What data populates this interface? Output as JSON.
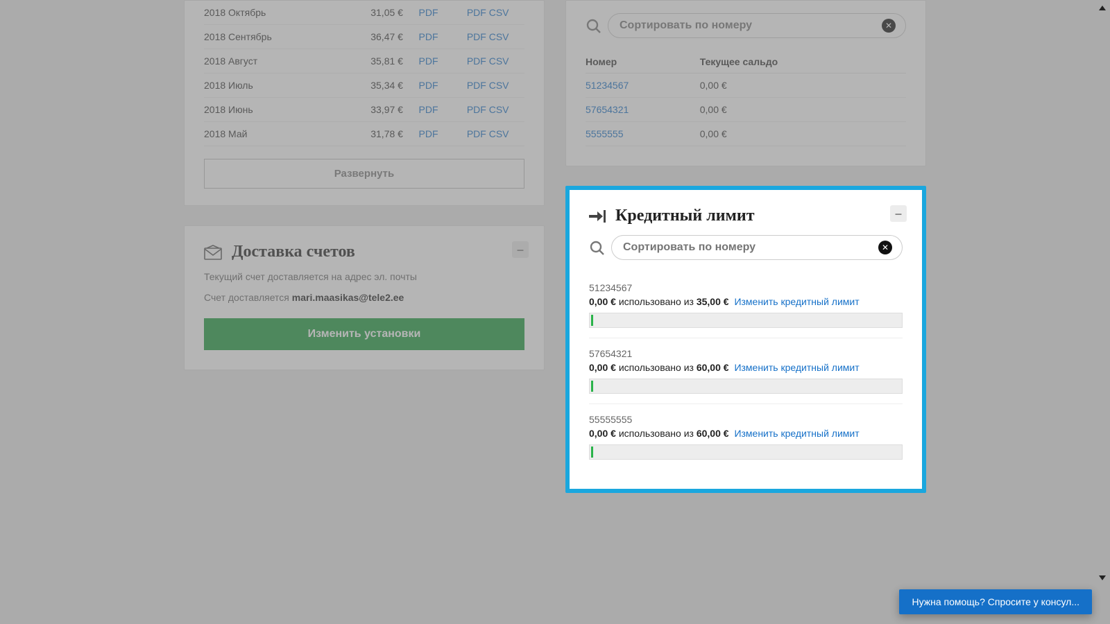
{
  "invoices": {
    "rows": [
      {
        "period": "2018 Октябрь",
        "amount": "31,05 €",
        "pdf": "PDF",
        "pdf2": "PDF",
        "csv": "CSV"
      },
      {
        "period": "2018 Сентябрь",
        "amount": "36,47 €",
        "pdf": "PDF",
        "pdf2": "PDF",
        "csv": "CSV"
      },
      {
        "period": "2018 Август",
        "amount": "35,81 €",
        "pdf": "PDF",
        "pdf2": "PDF",
        "csv": "CSV"
      },
      {
        "period": "2018 Июль",
        "amount": "35,34 €",
        "pdf": "PDF",
        "pdf2": "PDF",
        "csv": "CSV"
      },
      {
        "period": "2018 Июнь",
        "amount": "33,97 €",
        "pdf": "PDF",
        "pdf2": "PDF",
        "csv": "CSV"
      },
      {
        "period": "2018 Май",
        "amount": "31,78 €",
        "pdf": "PDF",
        "pdf2": "PDF",
        "csv": "CSV"
      }
    ],
    "expand": "Развернуть"
  },
  "delivery": {
    "title": "Доставка счетов",
    "line1": "Текущий счет доставляется на адрес эл. почты",
    "line2_prefix": "Счет доставляется ",
    "email": "mari.maasikas@tele2.ee",
    "change": "Изменить установки"
  },
  "balance": {
    "search_placeholder": "Сортировать по номеру",
    "head_num": "Номер",
    "head_bal": "Текущее сальдо",
    "rows": [
      {
        "num": "51234567",
        "bal": "0,00 €"
      },
      {
        "num": "57654321",
        "bal": "0,00 €"
      },
      {
        "num": "5555555",
        "bal": "0,00 €"
      }
    ]
  },
  "credit": {
    "title": "Кредитный лимит",
    "search_placeholder": "Сортировать по номеру",
    "change_label": "Изменить кредитный лимит",
    "used_word": "использовано из",
    "items": [
      {
        "num": "51234567",
        "used": "0,00 €",
        "limit": "35,00 €"
      },
      {
        "num": "57654321",
        "used": "0,00 €",
        "limit": "60,00 €"
      },
      {
        "num": "55555555",
        "used": "0,00 €",
        "limit": "60,00 €"
      }
    ]
  },
  "help": "Нужна помощь? Спросите у консул..."
}
